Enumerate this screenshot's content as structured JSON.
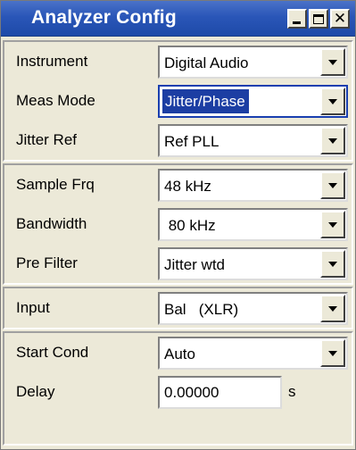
{
  "window": {
    "title": "Analyzer Config",
    "close_glyph": "✕"
  },
  "groups": [
    {
      "rows": [
        {
          "label": "Instrument",
          "value": "Digital Audio"
        },
        {
          "label": "Meas Mode",
          "value": "Jitter/Phase",
          "focused": true
        },
        {
          "label": "Jitter Ref",
          "value": "Ref PLL"
        }
      ]
    },
    {
      "rows": [
        {
          "label": "Sample Frq",
          "value": "48 kHz"
        },
        {
          "label": "Bandwidth",
          "value": " 80 kHz"
        },
        {
          "label": "Pre Filter",
          "value": "Jitter wtd"
        }
      ]
    },
    {
      "rows": [
        {
          "label": "Input",
          "value": "Bal   (XLR)"
        }
      ]
    },
    {
      "rows": [
        {
          "label": "Start Cond",
          "value": "Auto"
        },
        {
          "label": "Delay",
          "value": "0.00000",
          "unit": "s",
          "editable": true
        }
      ]
    }
  ],
  "colors": {
    "title_bar": "#2a56b8",
    "selection": "#1c3ea3",
    "panel": "#ece9d8"
  }
}
